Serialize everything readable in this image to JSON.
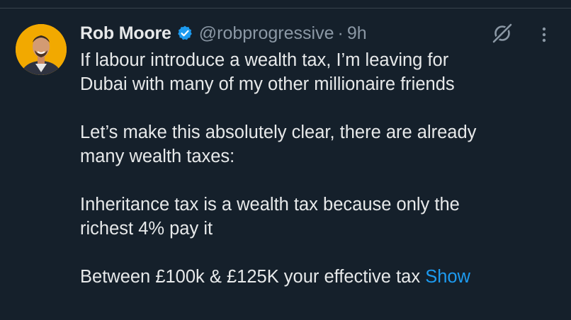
{
  "tweet": {
    "author_name": "Rob Moore",
    "handle": "@robprogressive",
    "separator": "·",
    "time": "9h",
    "avatar_icon": "avatar-photo",
    "verified_icon": "verified-badge-icon",
    "grok_icon": "grok-icon",
    "more_icon": "more-icon",
    "paragraphs": [
      {
        "lines": [
          "If labour introduce a wealth tax, I’m leaving for",
          "Dubai with many of my other millionaire friends"
        ]
      },
      {
        "lines": [
          "Let’s make this absolutely clear, there are already",
          "many wealth taxes:"
        ]
      },
      {
        "lines": [
          "Inheritance tax is a wealth tax because only the",
          "richest 4% pay it"
        ]
      },
      {
        "lines": [
          "Between £100k & £125K your effective tax"
        ]
      }
    ],
    "show_more_label": "Show"
  },
  "colors": {
    "background": "#15202b",
    "text": "#e7e9ea",
    "secondary": "#8b98a5",
    "link": "#1d9bf0",
    "verified": "#1d9bf0"
  }
}
